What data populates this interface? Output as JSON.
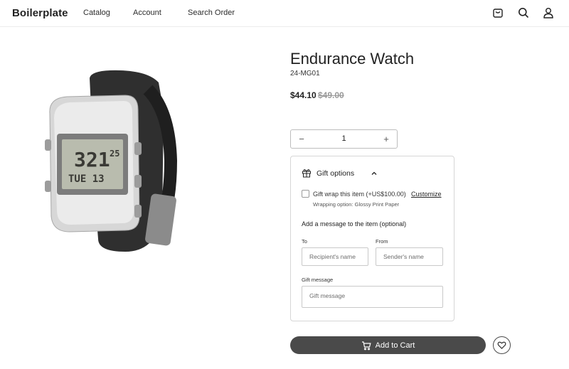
{
  "header": {
    "logo": "Boilerplate",
    "nav": [
      "Catalog",
      "Account",
      "Search Order"
    ],
    "icons": [
      "cart-icon",
      "search-icon",
      "user-icon"
    ]
  },
  "product": {
    "image_alt": "Endurance Watch",
    "title": "Endurance Watch",
    "sku": "24-MG01",
    "price": "$44.10",
    "old_price": "$49.00",
    "quantity": "1",
    "decrement_symbol": "−",
    "increment_symbol": "+"
  },
  "gift": {
    "title": "Gift options",
    "wrap_label": "Gift wrap this item (+US$100.00)",
    "customize": "Customize",
    "wrap_option": "Wrapping option: Glossy Print Paper",
    "message_heading": "Add a message to the item (optional)",
    "to_label": "To",
    "to_placeholder": "Recipient's name",
    "from_label": "From",
    "from_placeholder": "Sender's name",
    "message_label": "Gift message",
    "message_placeholder": "Gift message"
  },
  "actions": {
    "add_to_cart": "Add to Cart"
  },
  "colors": {
    "button": "#4a4a4a",
    "text": "#2c2c2c",
    "strike": "#9a9a9a"
  }
}
